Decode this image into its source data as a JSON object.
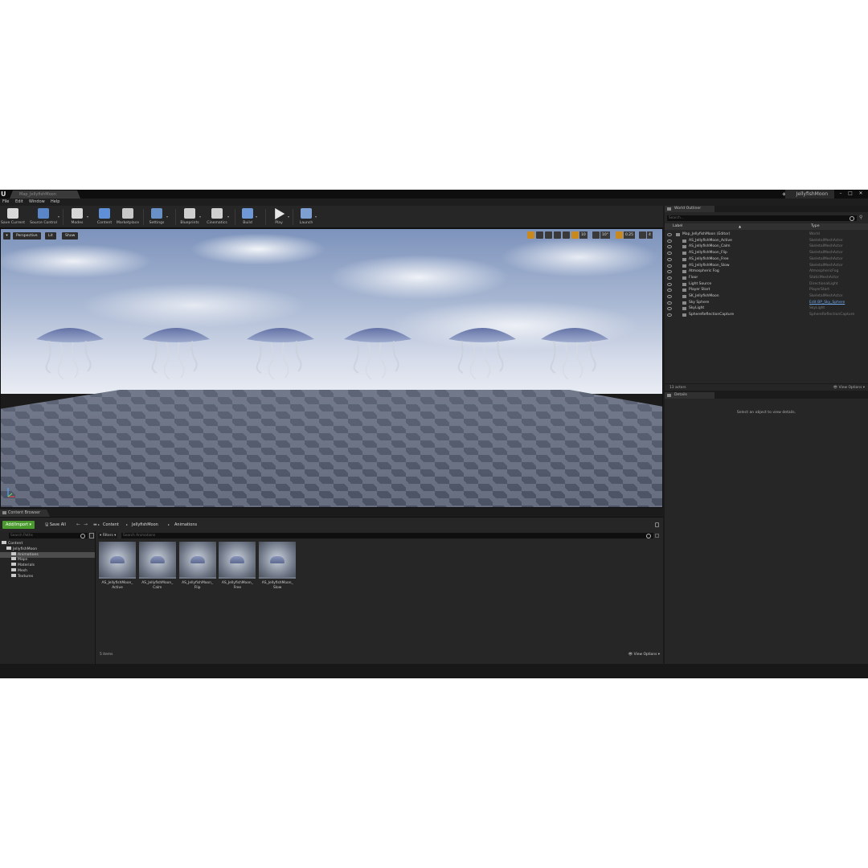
{
  "title_bar": {
    "doc_tab": "Map_JellyfishMoon",
    "project_name": "JellyfishMoon",
    "window_controls": [
      "minimize-icon",
      "maximize-icon",
      "close-icon"
    ]
  },
  "menu": [
    "File",
    "Edit",
    "Window",
    "Help"
  ],
  "toolbar": [
    {
      "label": "Save Current",
      "icon": "save-icon",
      "color": "#d9d9d9"
    },
    {
      "label": "Source Control",
      "icon": "source-control-icon",
      "color": "#5a86c8"
    },
    {
      "label": "Modes",
      "icon": "modes-icon",
      "color": "#d6d6d6"
    },
    {
      "label": "Content",
      "icon": "content-icon",
      "color": "#5f8fd6"
    },
    {
      "label": "Marketplace",
      "icon": "marketplace-icon",
      "color": "#c8c8c8"
    },
    {
      "label": "Settings",
      "icon": "settings-icon",
      "color": "#6a90c8"
    },
    {
      "label": "Blueprints",
      "icon": "blueprints-icon",
      "color": "#cfcfcf"
    },
    {
      "label": "Cinematics",
      "icon": "cinematics-icon",
      "color": "#d0d0d0"
    },
    {
      "label": "Build",
      "icon": "build-icon",
      "color": "#6f98d6"
    },
    {
      "label": "Play",
      "icon": "play-icon",
      "color": "#e6e6e6"
    },
    {
      "label": "Launch",
      "icon": "launch-icon",
      "color": "#7ea0d0"
    }
  ],
  "viewport": {
    "perspective": "Perspective",
    "lit": "Lit",
    "show": "Show",
    "grid_size": "10",
    "rotation_snap": "10°",
    "scale_snap": "0.25",
    "camera_speed": "4"
  },
  "content_browser": {
    "tab": "Content Browser",
    "add_import": "Add/Import",
    "save_all": "Save All",
    "breadcrumb": [
      "Content",
      "JellyfishMoon",
      "Animations"
    ],
    "search_paths_placeholder": "Search Paths",
    "filters": "Filters",
    "search_assets_placeholder": "Search Animations",
    "tree": [
      {
        "label": "Content",
        "level": 0,
        "selected": false
      },
      {
        "label": "JellyfishMoon",
        "level": 1,
        "selected": false
      },
      {
        "label": "Animations",
        "level": 2,
        "selected": true
      },
      {
        "label": "Maps",
        "level": 2,
        "selected": false
      },
      {
        "label": "Materials",
        "level": 2,
        "selected": false
      },
      {
        "label": "Mesh",
        "level": 2,
        "selected": false
      },
      {
        "label": "Textures",
        "level": 2,
        "selected": false
      }
    ],
    "assets": [
      {
        "line1": "AS_JellyfishMoon_",
        "line2": "Active"
      },
      {
        "line1": "AS_JellyfishMoon_",
        "line2": "Calm"
      },
      {
        "line1": "AS_JellyfishMoon_",
        "line2": "Flip"
      },
      {
        "line1": "AS_JellyfishMoon_",
        "line2": "Free"
      },
      {
        "line1": "AS_JellyfishMoon_",
        "line2": "Slow"
      }
    ],
    "items_count": "5 items",
    "view_options": "View Options"
  },
  "world_outliner": {
    "tab": "World Outliner",
    "search_placeholder": "Search...",
    "col_label": "Label",
    "col_type": "Type",
    "rows": [
      {
        "label": "Map_JellyfishMoon (Editor)",
        "type": "World",
        "indent": 0,
        "link": false
      },
      {
        "label": "AS_JellyfishMoon_Active",
        "type": "SkeletalMeshActor",
        "indent": 1,
        "link": false
      },
      {
        "label": "AS_JellyfishMoon_Calm",
        "type": "SkeletalMeshActor",
        "indent": 1,
        "link": false
      },
      {
        "label": "AS_JellyfishMoon_Flip",
        "type": "SkeletalMeshActor",
        "indent": 1,
        "link": false
      },
      {
        "label": "AS_JellyfishMoon_Free",
        "type": "SkeletalMeshActor",
        "indent": 1,
        "link": false
      },
      {
        "label": "AS_JellyfishMoon_Slow",
        "type": "SkeletalMeshActor",
        "indent": 1,
        "link": false
      },
      {
        "label": "Atmospheric Fog",
        "type": "AtmosphericFog",
        "indent": 1,
        "link": false
      },
      {
        "label": "Floor",
        "type": "StaticMeshActor",
        "indent": 1,
        "link": false
      },
      {
        "label": "Light Source",
        "type": "DirectionalLight",
        "indent": 1,
        "link": false
      },
      {
        "label": "Player Start",
        "type": "PlayerStart",
        "indent": 1,
        "link": false
      },
      {
        "label": "SK_JellyfishMoon",
        "type": "SkeletalMeshActor",
        "indent": 1,
        "link": false
      },
      {
        "label": "Sky Sphere",
        "type": "Edit BP_Sky_Sphere",
        "indent": 1,
        "link": true
      },
      {
        "label": "SkyLight",
        "type": "SkyLight",
        "indent": 1,
        "link": false
      },
      {
        "label": "SphereReflectionCapture",
        "type": "SphereReflectionCapture",
        "indent": 1,
        "link": false
      }
    ],
    "actor_count": "13 actors",
    "view_options": "View Options"
  },
  "details": {
    "tab": "Details",
    "empty_message": "Select an object to view details."
  }
}
